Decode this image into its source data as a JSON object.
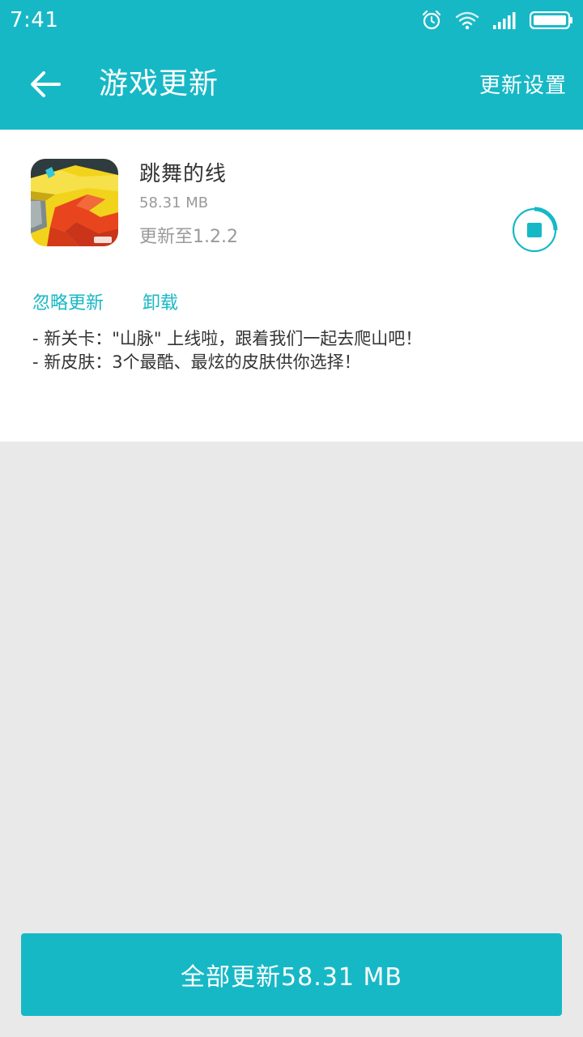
{
  "status_bar": {
    "time": "7:41",
    "icons": [
      "alarm-icon",
      "wifi-icon",
      "signal-icon",
      "battery-icon"
    ]
  },
  "app_bar": {
    "back_icon": "arrow-left-icon",
    "title": "游戏更新",
    "settings_label": "更新设置"
  },
  "update_item": {
    "name": "跳舞的线",
    "size": "58.31 MB",
    "version_text": "更新至1.2.2",
    "status_icon": "download-pause-icon",
    "progress_percent": 25,
    "ignore_label": "忽略更新",
    "uninstall_label": "卸载",
    "notes": [
      "- 新关卡：\"山脉\" 上线啦，跟着我们一起去爬山吧！",
      "- 新皮肤：3个最酷、最炫的皮肤供你选择！"
    ]
  },
  "footer": {
    "update_all_label": "全部更新58.31 MB"
  },
  "colors": {
    "accent": "#17b8c6",
    "background": "#e9e9e9",
    "card": "#ffffff"
  }
}
